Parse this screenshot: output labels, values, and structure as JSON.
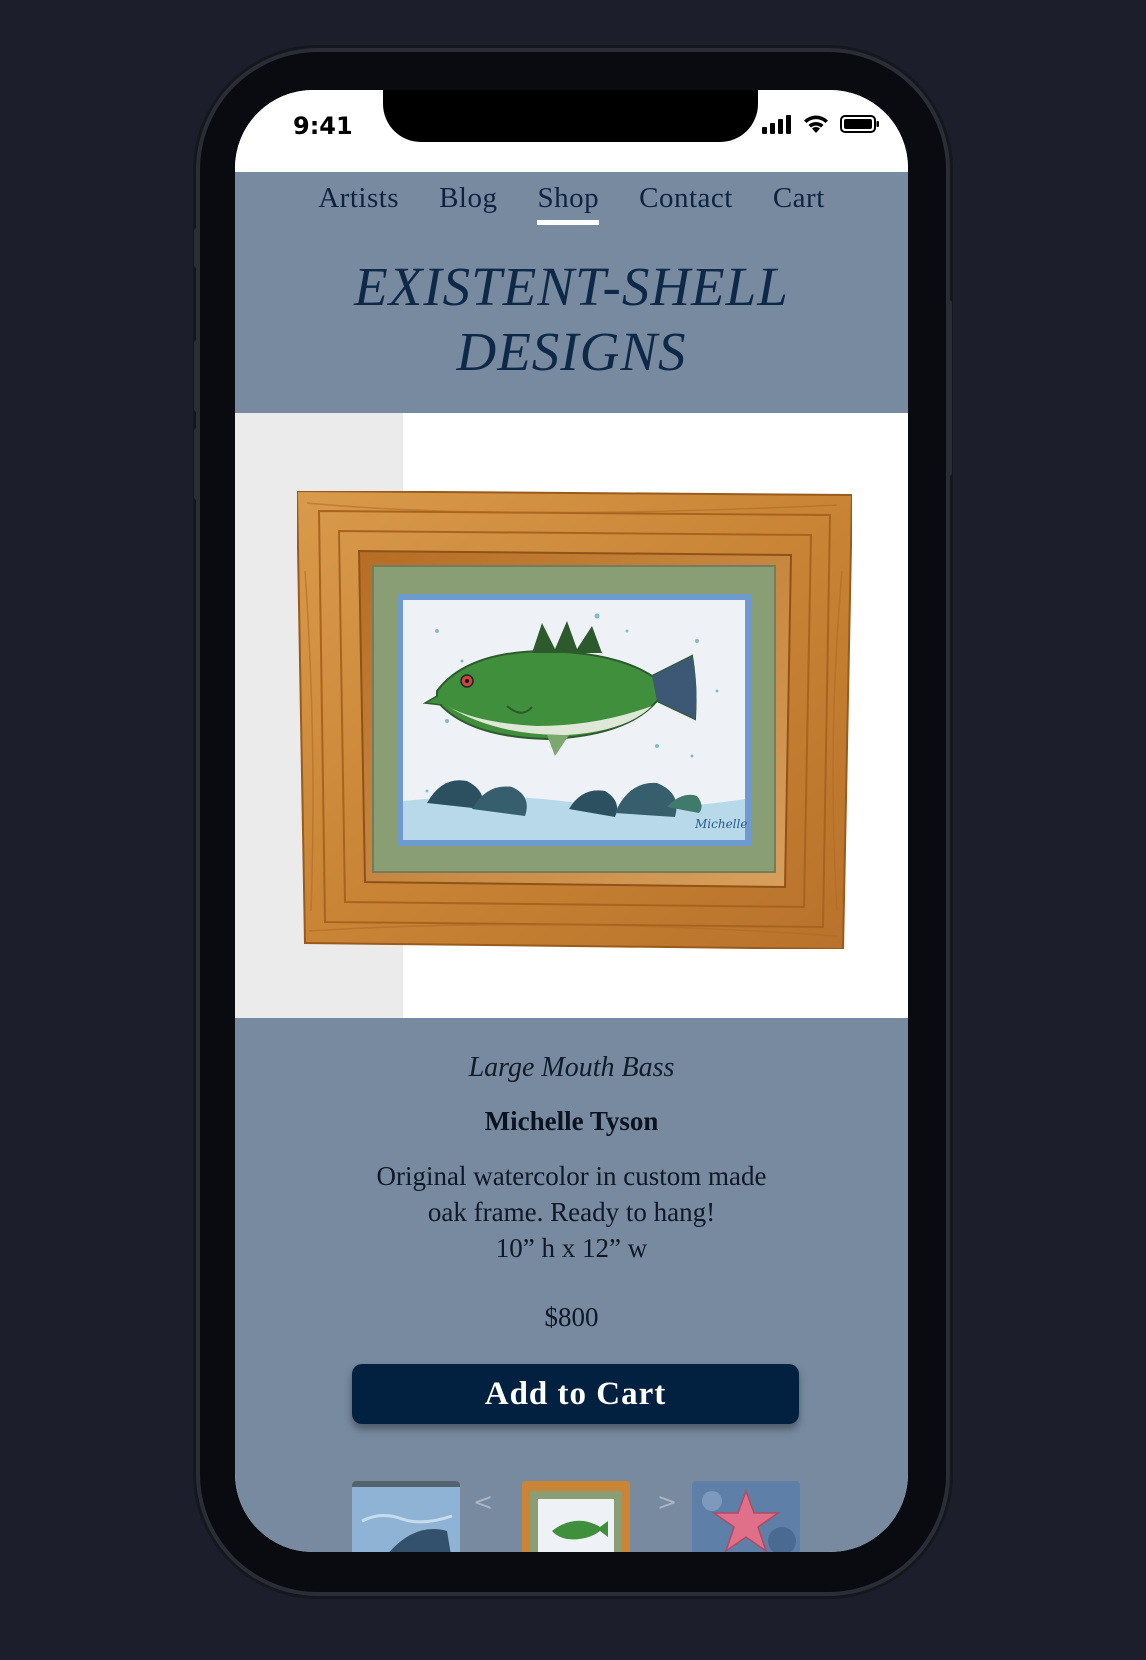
{
  "status_bar": {
    "time": "9:41"
  },
  "nav": {
    "items": [
      {
        "label": "Artists",
        "active": false
      },
      {
        "label": "Blog",
        "active": false
      },
      {
        "label": "Shop",
        "active": true
      },
      {
        "label": "Contact",
        "active": false
      },
      {
        "label": "Cart",
        "active": false
      }
    ]
  },
  "brand": {
    "line1": "EXISTENT-SHELL",
    "line2": "DESIGNS"
  },
  "product": {
    "title": "Large Mouth Bass",
    "artist": "Michelle Tyson",
    "description_line1": "Original watercolor in custom made",
    "description_line2": "oak frame. Ready to hang!",
    "dimensions": "10” h x 12” w",
    "price": "$800",
    "add_to_cart_label": "Add to Cart"
  },
  "carousel": {
    "prev_arrow": "<",
    "next_arrow": ">",
    "thumbnails": [
      "stingray-thumbnail",
      "bass-thumbnail",
      "starfish-thumbnail"
    ]
  },
  "colors": {
    "header_bg": "#778a9f",
    "accent_dark": "#022141",
    "page_bg": "#1c1f2b"
  }
}
